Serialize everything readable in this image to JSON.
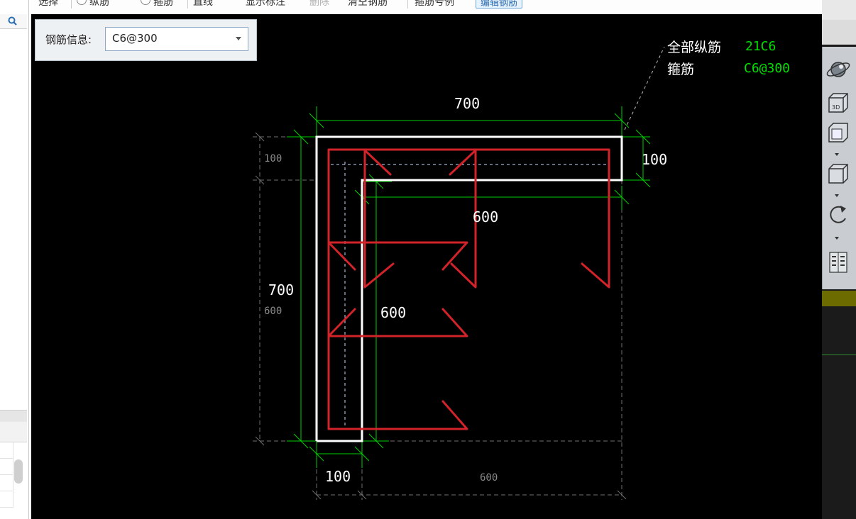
{
  "toolbar": {
    "items": [
      "选择",
      "纵筋",
      "箍筋",
      "直线",
      "显示标注",
      "删除",
      "清空钢筋",
      "箍筋号例",
      "编辑钢筋"
    ]
  },
  "info": {
    "label": "钢筋信息:",
    "value": "C6@300"
  },
  "legend": {
    "longitudinal_label": "全部纵筋",
    "longitudinal_value": "21C6",
    "stirrup_label": "箍筋",
    "stirrup_value": "C6@300"
  },
  "dimensions": {
    "top_width": "700",
    "top_thickness": "100",
    "inner_width": "600",
    "left_height": "700",
    "inner_height": "600",
    "bottom_width": "100",
    "left_gray_thickness": "100",
    "left_gray_height": "600",
    "bottom_gray_width": "600"
  },
  "colors": {
    "canvas_bg": "#000000",
    "outline": "#ffffff",
    "rebar": "#d2232a",
    "dimension_line": "#00d000",
    "legend_value": "#00e000",
    "gray_dim": "#8a8a8a"
  }
}
